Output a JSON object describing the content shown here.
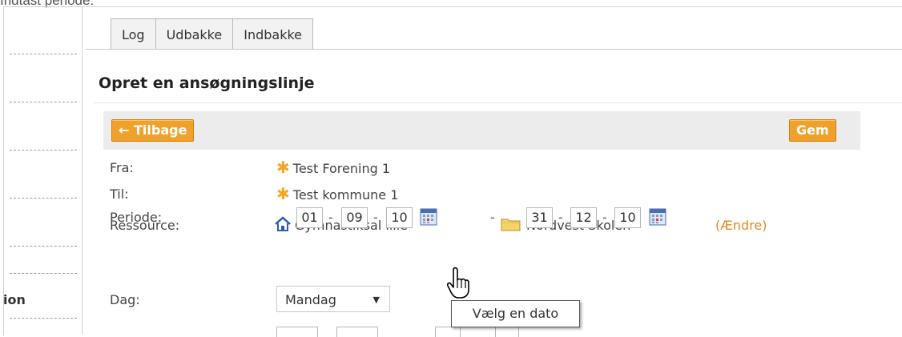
{
  "caption": "Indtast periode:",
  "sidebar": {
    "partial_label": "ion"
  },
  "tabs": [
    {
      "label": "Log"
    },
    {
      "label": "Udbakke"
    },
    {
      "label": "Indbakke"
    }
  ],
  "page_title": "Opret en ansøgningslinje",
  "toolbar": {
    "back_label": "Tilbage",
    "save_label": "Gem"
  },
  "form": {
    "fra": {
      "label": "Fra:",
      "value": "Test Forening 1"
    },
    "til": {
      "label": "Til:",
      "value": "Test kommune 1"
    },
    "ressource": {
      "label": "Ressource:",
      "room": "Gymnastiksal lille",
      "location": "Nordvest Skolen",
      "change_open": "(",
      "change_link": "Ændre",
      "change_close": ")"
    },
    "periode": {
      "label": "Periode:",
      "from": [
        "01",
        "09",
        "10"
      ],
      "to": [
        "31",
        "12",
        "10"
      ],
      "range_sep": "-",
      "date_sep": "-"
    },
    "dag": {
      "label": "Dag:",
      "value": "Mandag"
    }
  },
  "tooltip": "Vælg en dato",
  "colors": {
    "accent": "#f0a12a",
    "toolbar_bg": "#ececec",
    "link": "#e08a1e"
  },
  "icons": {
    "back": "arrow-left-icon",
    "org": "asterisk-icon",
    "room": "house-icon",
    "folder": "folder-icon",
    "calendar": "calendar-icon",
    "cursor": "hand-pointer-icon"
  }
}
